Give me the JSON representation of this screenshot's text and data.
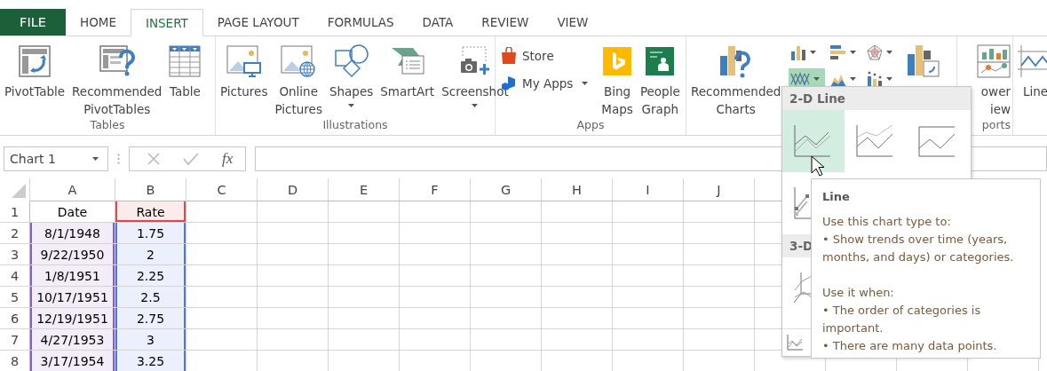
{
  "tabs": [
    {
      "label": "FILE",
      "kind": "file",
      "selected": false
    },
    {
      "label": "HOME",
      "kind": "tab",
      "selected": false
    },
    {
      "label": "INSERT",
      "kind": "tab",
      "selected": true
    },
    {
      "label": "PAGE LAYOUT",
      "kind": "tab",
      "selected": false
    },
    {
      "label": "FORMULAS",
      "kind": "tab",
      "selected": false
    },
    {
      "label": "DATA",
      "kind": "tab",
      "selected": false
    },
    {
      "label": "REVIEW",
      "kind": "tab",
      "selected": false
    },
    {
      "label": "VIEW",
      "kind": "tab",
      "selected": false
    }
  ],
  "ribbon": [
    {
      "label": "Tables",
      "items": [
        {
          "kind": "pivottable",
          "lines": [
            "PivotTable"
          ]
        },
        {
          "kind": "suggestpivot",
          "lines": [
            "Recommended",
            "PivotTables"
          ]
        },
        {
          "kind": "table",
          "lines": [
            "Table"
          ]
        }
      ]
    },
    {
      "label": "Illustrations",
      "items": [
        {
          "kind": "pictures",
          "lines": [
            "Pictures"
          ]
        },
        {
          "kind": "onlinepictures",
          "lines": [
            "Online",
            "Pictures"
          ]
        },
        {
          "kind": "shapes",
          "lines": [
            "Shapes"
          ],
          "dropdown": true
        },
        {
          "kind": "smartart",
          "lines": [
            "SmartArt"
          ]
        },
        {
          "kind": "screenshot",
          "lines": [
            "Screenshot"
          ],
          "dropdown": true
        }
      ]
    },
    {
      "label": "Apps",
      "items": [
        {
          "kind": "stack",
          "buttons": [
            {
              "kind": "store",
              "label": "Store"
            },
            {
              "kind": "apps",
              "label": "My Apps",
              "dropdown": true
            }
          ]
        },
        {
          "kind": "bing",
          "lines": [
            "Bing",
            "Maps"
          ]
        },
        {
          "kind": "peoplegraph",
          "lines": [
            "People",
            "Graph"
          ]
        }
      ]
    },
    {
      "items": [
        {
          "kind": "suggestcharts",
          "lines": [
            "Recommended",
            "Charts"
          ]
        },
        {
          "kind": "gallery",
          "buttons": [
            {
              "kind": "column",
              "selected": false
            },
            {
              "kind": "bar",
              "selected": false
            },
            {
              "kind": "radar",
              "selected": false
            },
            {
              "kind": "line",
              "selected": true
            },
            {
              "kind": "area",
              "selected": false
            },
            {
              "kind": "combo",
              "selected": false
            }
          ]
        },
        {
          "kind": "pivotchart"
        }
      ]
    },
    {
      "label": "ports",
      "items": [
        {
          "kind": "powerview",
          "lines": [
            "ower",
            "iew"
          ]
        }
      ]
    },
    {
      "items": [
        {
          "kind": "sparkline",
          "lines": [
            "Line"
          ]
        }
      ]
    }
  ],
  "formula_bar": {
    "name_box": "Chart 1",
    "function_label": "fx"
  },
  "sheet": {
    "columns": [
      "A",
      "B",
      "C",
      "D",
      "E",
      "F",
      "G",
      "H",
      "I",
      "J"
    ],
    "rows": [
      {
        "header": "1",
        "cells": [
          {
            "text": "Date"
          },
          {
            "text": "Rate",
            "color": "#e0474c"
          }
        ]
      },
      {
        "header": "2",
        "cells": [
          {
            "text": "8/1/1948",
            "color": "#8a5cc8"
          },
          {
            "text": "1.75",
            "color": "#4a78e0"
          }
        ]
      },
      {
        "header": "3",
        "cells": [
          {
            "text": "9/22/1950",
            "color": "#8a5cc8"
          },
          {
            "text": "2",
            "color": "#4a78e0"
          }
        ]
      },
      {
        "header": "4",
        "cells": [
          {
            "text": "1/8/1951",
            "color": "#8a5cc8"
          },
          {
            "text": "2.25",
            "color": "#4a78e0"
          }
        ]
      },
      {
        "header": "5",
        "cells": [
          {
            "text": "10/17/1951",
            "color": "#8a5cc8"
          },
          {
            "text": "2.5",
            "color": "#4a78e0"
          }
        ]
      },
      {
        "header": "6",
        "cells": [
          {
            "text": "12/19/1951",
            "color": "#8a5cc8"
          },
          {
            "text": "2.75",
            "color": "#4a78e0"
          }
        ]
      },
      {
        "header": "7",
        "cells": [
          {
            "text": "4/27/1953",
            "color": "#8a5cc8"
          },
          {
            "text": "3",
            "color": "#4a78e0"
          }
        ]
      },
      {
        "header": "8",
        "cells": [
          {
            "text": "3/17/1954",
            "color": "#8a5cc8"
          },
          {
            "text": "3.25",
            "color": "#4a78e0"
          }
        ]
      }
    ]
  },
  "gallery": {
    "sections": [
      {
        "heading": "2-D Line",
        "tiles": [
          {
            "kind": "line",
            "selected": true
          },
          {
            "kind": "stacked",
            "selected": false
          },
          {
            "kind": "percent",
            "selected": false
          },
          {
            "kind": "markers",
            "selected": false
          }
        ]
      },
      {
        "heading": "3-D",
        "tiles": [
          {
            "kind": "threed",
            "selected": false
          }
        ]
      }
    ],
    "more": {
      "kind": "more"
    }
  },
  "tooltip": {
    "title": "Line",
    "paragraphs": [
      [
        "Use this chart type to:",
        "• Show trends over time (years, months, and days) or categories."
      ],
      [
        "Use it when:",
        "• The order of categories is important.",
        "• There are many data points."
      ]
    ]
  }
}
